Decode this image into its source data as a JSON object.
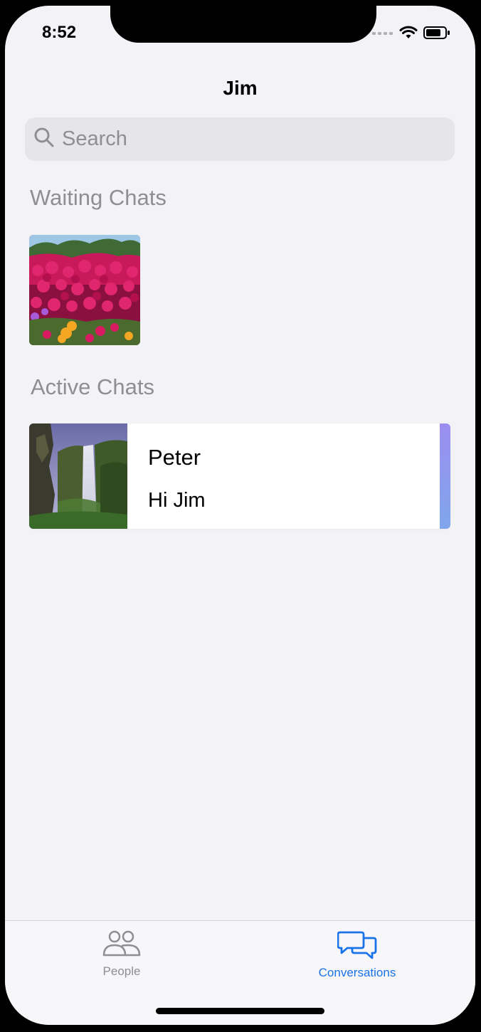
{
  "status_bar": {
    "time": "8:52",
    "icons": [
      "cellular-signal-icon",
      "wifi-icon",
      "battery-icon"
    ]
  },
  "nav": {
    "title": "Jim"
  },
  "search": {
    "placeholder": "Search",
    "value": ""
  },
  "sections": {
    "waiting_title": "Waiting Chats",
    "active_title": "Active Chats"
  },
  "waiting_chats": [
    {
      "avatar": "flower-field-photo"
    }
  ],
  "active_chats": [
    {
      "name": "Peter",
      "last_message": "Hi Jim",
      "avatar": "waterfall-photo",
      "accent_color": "#9b8ef0"
    }
  ],
  "tab_bar": {
    "tabs": [
      {
        "label": "People",
        "icon": "people-icon",
        "selected": false
      },
      {
        "label": "Conversations",
        "icon": "chat-bubbles-icon",
        "selected": true
      }
    ]
  },
  "colors": {
    "background": "#f2f2f7",
    "accent_blue": "#1a73e8",
    "secondary_text": "#8e8e93"
  }
}
